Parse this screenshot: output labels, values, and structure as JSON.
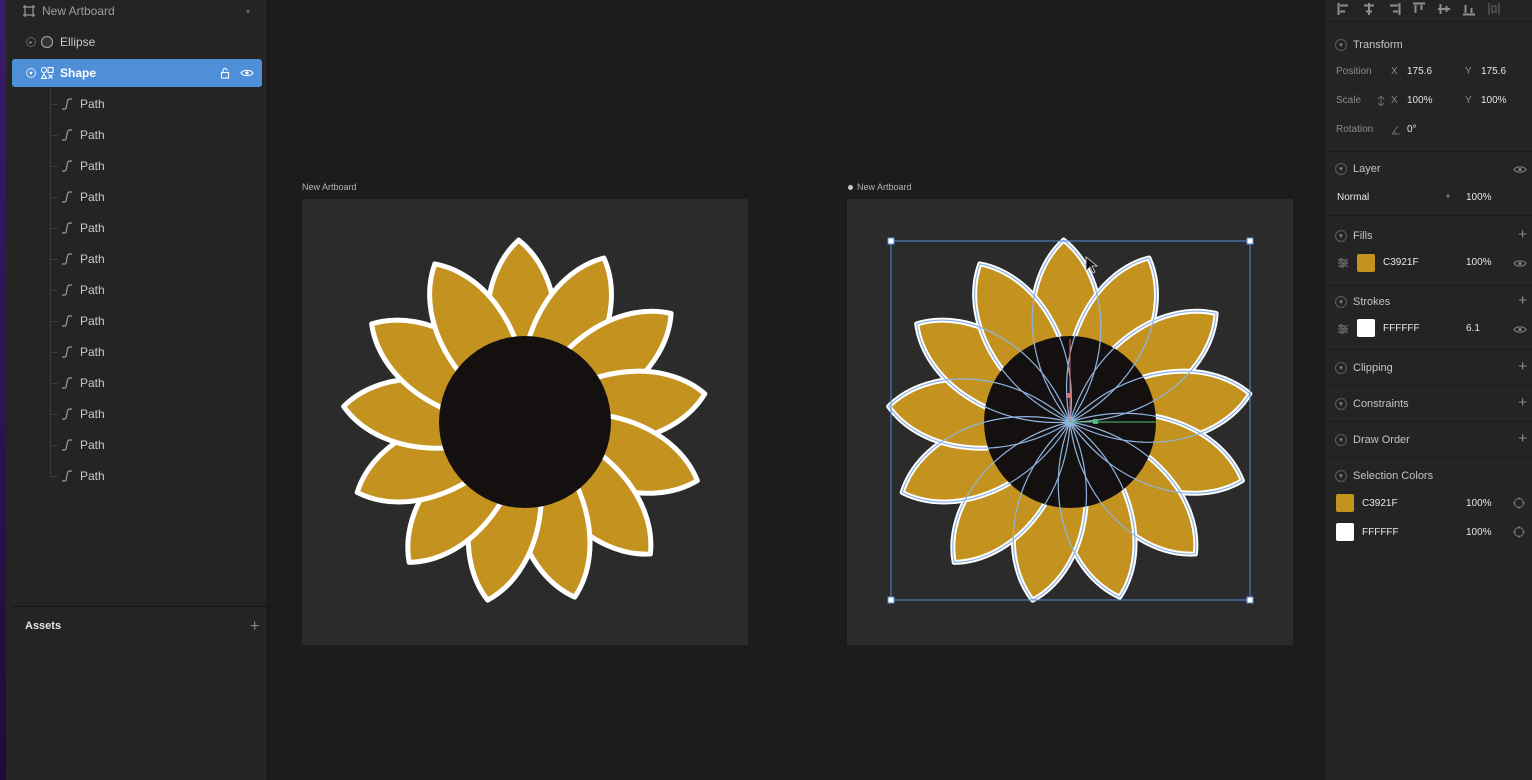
{
  "layers": {
    "artboard": "New Artboard",
    "ellipse": "Ellipse",
    "shape": "Shape",
    "path_label": "Path",
    "path_count": 13
  },
  "assets": {
    "title": "Assets"
  },
  "canvas": {
    "left_artboard_label": "New Artboard",
    "right_artboard_label": "New Artboard",
    "colors": {
      "petal": "#C3921F",
      "center": "#151010",
      "stroke": "#FFFFFF",
      "selection": "#4f8fd8"
    }
  },
  "inspector": {
    "transform": {
      "title": "Transform",
      "position_label": "Position",
      "x_label": "X",
      "y_label": "Y",
      "pos_x": "175.6",
      "pos_y": "175.6",
      "scale_label": "Scale",
      "scale_x": "100%",
      "scale_y": "100%",
      "rotation_label": "Rotation",
      "rotation": "0°"
    },
    "layer": {
      "title": "Layer",
      "blend": "Normal",
      "opacity": "100%"
    },
    "fills": {
      "title": "Fills",
      "hex": "C3921F",
      "opacity": "100%",
      "color": "#C3921F"
    },
    "strokes": {
      "title": "Strokes",
      "hex": "FFFFFF",
      "width": "6.1",
      "color": "#FFFFFF"
    },
    "clipping": {
      "title": "Clipping"
    },
    "constraints": {
      "title": "Constraints"
    },
    "draw_order": {
      "title": "Draw Order"
    },
    "selection_colors": {
      "title": "Selection Colors",
      "items": [
        {
          "hex": "C3921F",
          "opacity": "100%",
          "color": "#C3921F"
        },
        {
          "hex": "FFFFFF",
          "opacity": "100%",
          "color": "#FFFFFF"
        }
      ]
    }
  }
}
